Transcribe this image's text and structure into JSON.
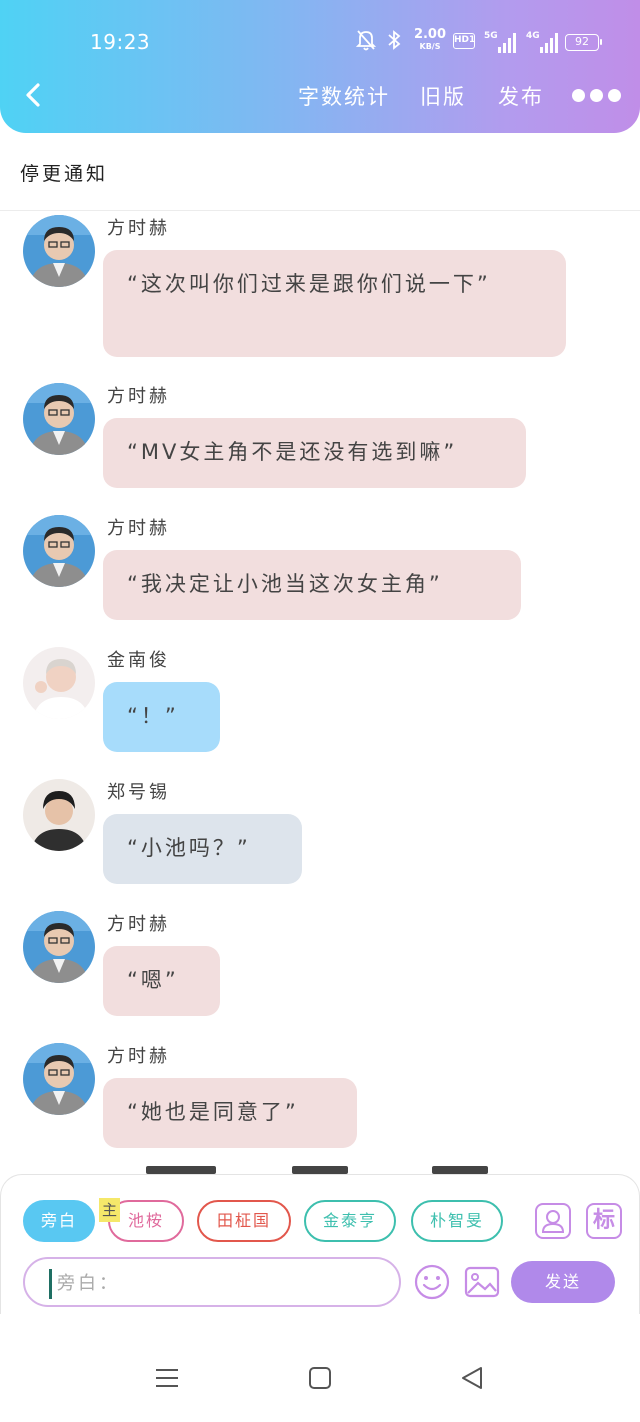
{
  "status_bar": {
    "time": "19:23",
    "speed_value": "2.00",
    "speed_unit": "KB/S",
    "hd_label": "HD1",
    "net_5g": "5G",
    "net_4g": "4G",
    "battery": "92"
  },
  "header": {
    "nav_links": [
      "字数统计",
      "旧版",
      "发布"
    ]
  },
  "title": "停更通知",
  "messages": [
    {
      "sender": "方时赫",
      "text": "“这次叫你们过来是跟你们说一下”",
      "color": "pink"
    },
    {
      "sender": "方时赫",
      "text": "“MV女主角不是还没有选到嘛”",
      "color": "pink"
    },
    {
      "sender": "方时赫",
      "text": "“我决定让小池当这次女主角”",
      "color": "pink"
    },
    {
      "sender": "金南俊",
      "text": "“！”",
      "color": "blue"
    },
    {
      "sender": "郑号锡",
      "text": "“小池吗？”",
      "color": "gray"
    },
    {
      "sender": "方时赫",
      "text": "“嗯”",
      "color": "pink"
    },
    {
      "sender": "方时赫",
      "text": "“她也是同意了”",
      "color": "pink"
    }
  ],
  "role_chips": [
    {
      "label": "旁白",
      "active": true,
      "color": "#59c8f2"
    },
    {
      "label": "池桉",
      "active": false,
      "color": "#e06a9c"
    },
    {
      "label": "田柾国",
      "active": false,
      "color": "#e2574c"
    },
    {
      "label": "金泰亨",
      "active": false,
      "color": "#3dbfae"
    },
    {
      "label": "朴智旻",
      "active": false,
      "color": "#3dbfae"
    }
  ],
  "main_badge": "主",
  "mark_button": "标",
  "input": {
    "placeholder": "旁白：",
    "value": ""
  },
  "send_label": "发送",
  "colors": {
    "accent_purple": "#b089ea",
    "bubble_pink": "#f2dede",
    "bubble_blue": "#a7dcfb",
    "bubble_gray": "#dde4ec"
  }
}
